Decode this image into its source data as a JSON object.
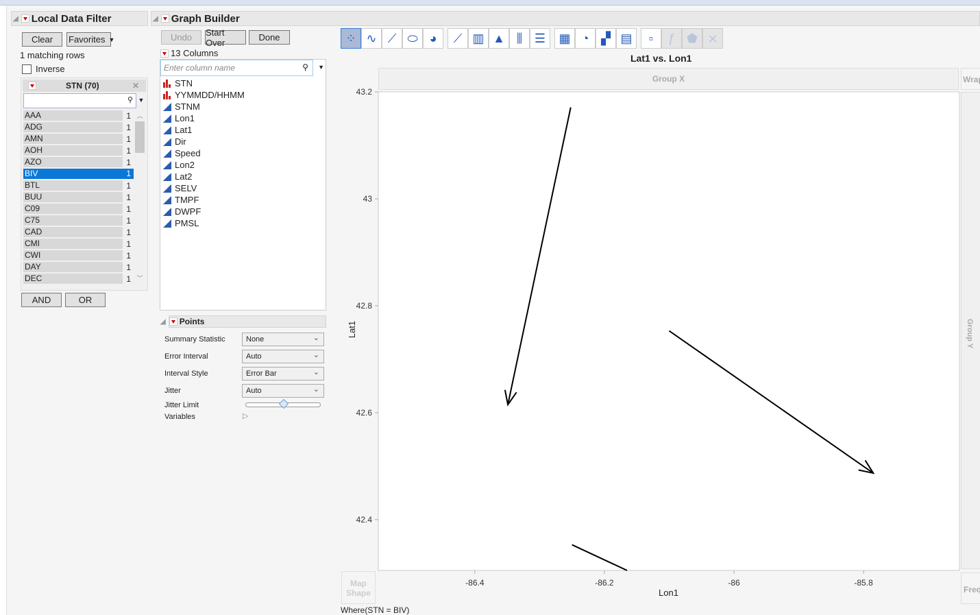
{
  "filter": {
    "title": "Local Data Filter",
    "clear": "Clear",
    "favorites": "Favorites",
    "matching": "1 matching rows",
    "inverse": "Inverse",
    "column_header": "STN (70)",
    "and": "AND",
    "or": "OR",
    "items": [
      {
        "n": "AAA",
        "c": "1"
      },
      {
        "n": "ADG",
        "c": "1"
      },
      {
        "n": "AMN",
        "c": "1"
      },
      {
        "n": "AOH",
        "c": "1"
      },
      {
        "n": "AZO",
        "c": "1"
      },
      {
        "n": "BIV",
        "c": "1",
        "selected": true
      },
      {
        "n": "BTL",
        "c": "1"
      },
      {
        "n": "BUU",
        "c": "1"
      },
      {
        "n": "C09",
        "c": "1"
      },
      {
        "n": "C75",
        "c": "1"
      },
      {
        "n": "CAD",
        "c": "1"
      },
      {
        "n": "CMI",
        "c": "1"
      },
      {
        "n": "CWI",
        "c": "1"
      },
      {
        "n": "DAY",
        "c": "1"
      },
      {
        "n": "DEC",
        "c": "1"
      }
    ]
  },
  "builder": {
    "title": "Graph Builder",
    "undo": "Undo",
    "start_over": "Start Over",
    "done": "Done",
    "columns_count": "13 Columns",
    "search_placeholder": "Enter column name",
    "columns": [
      {
        "n": "STN",
        "t": "nom"
      },
      {
        "n": "YYMMDD/HHMM",
        "t": "nom"
      },
      {
        "n": "STNM",
        "t": "cont"
      },
      {
        "n": "Lon1",
        "t": "cont"
      },
      {
        "n": "Lat1",
        "t": "cont"
      },
      {
        "n": "Dir",
        "t": "cont"
      },
      {
        "n": "Speed",
        "t": "cont"
      },
      {
        "n": "Lon2",
        "t": "cont"
      },
      {
        "n": "Lat2",
        "t": "cont"
      },
      {
        "n": "SELV",
        "t": "cont"
      },
      {
        "n": "TMPF",
        "t": "cont"
      },
      {
        "n": "DWPF",
        "t": "cont"
      },
      {
        "n": "PMSL",
        "t": "cont"
      }
    ],
    "points": {
      "title": "Points",
      "summary_label": "Summary Statistic",
      "summary_value": "None",
      "error_label": "Error Interval",
      "error_value": "Auto",
      "style_label": "Interval Style",
      "style_value": "Error Bar",
      "jitter_label": "Jitter",
      "jitter_value": "Auto",
      "jitter_limit_label": "Jitter Limit",
      "jitter_limit": 0.5,
      "variables_label": "Variables"
    }
  },
  "graph": {
    "group_x": "Group X",
    "group_y": "Group Y",
    "wrap": "Wrap",
    "freq": "Freq",
    "map_shape": "Map Shape",
    "where": "Where(STN = BIV)"
  },
  "chart_data": {
    "type": "line",
    "title": "Lat1 vs. Lon1",
    "xlabel": "Lon1",
    "ylabel": "Lat1",
    "xlim": [
      -86.549,
      -85.652
    ],
    "ylim": [
      42.305,
      43.2
    ],
    "xticks": [
      "-86.4",
      "-86.2",
      "-86",
      "-85.8"
    ],
    "xtick_values": [
      -86.4,
      -86.2,
      -86,
      -85.8
    ],
    "yticks": [
      "43.2",
      "43",
      "42.8",
      "42.6",
      "42.4"
    ],
    "ytick_values": [
      43.2,
      43,
      42.8,
      42.6,
      42.4
    ],
    "segments": [
      {
        "x1": -86.252,
        "y1": 43.171,
        "x2": -86.349,
        "y2": 42.615,
        "arrow": true
      },
      {
        "x1": -86.1,
        "y1": 42.753,
        "x2": -85.785,
        "y2": 42.487,
        "arrow": true
      },
      {
        "x1": -86.25,
        "y1": 42.353,
        "x2": -86.165,
        "y2": 42.305,
        "arrow": false
      }
    ]
  }
}
